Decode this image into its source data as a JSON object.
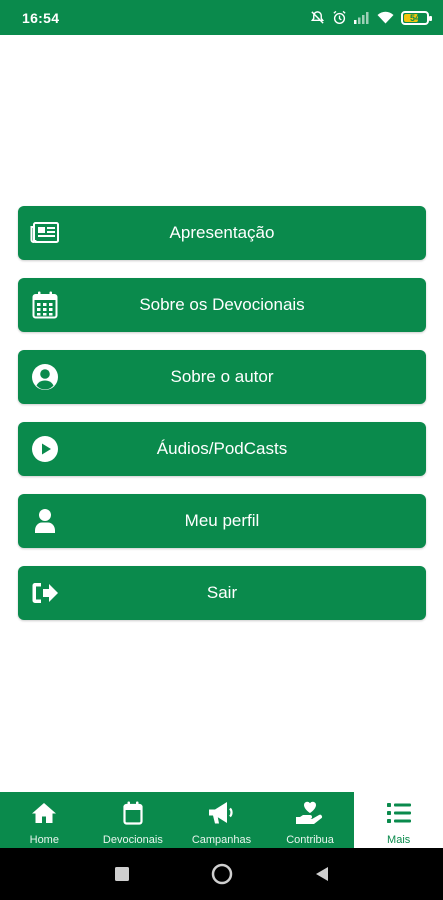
{
  "status_bar": {
    "time": "16:54",
    "battery": "54"
  },
  "menu": {
    "items": [
      {
        "label": "Apresentação",
        "icon": "newspaper-icon"
      },
      {
        "label": "Sobre os Devocionais",
        "icon": "calendar-icon"
      },
      {
        "label": "Sobre o autor",
        "icon": "user-circle-icon"
      },
      {
        "label": "Áudios/PodCasts",
        "icon": "play-circle-icon"
      },
      {
        "label": "Meu perfil",
        "icon": "user-icon"
      },
      {
        "label": "Sair",
        "icon": "sign-out-icon"
      }
    ]
  },
  "bottom_nav": {
    "items": [
      {
        "label": "Home",
        "icon": "home-icon"
      },
      {
        "label": "Devocionais",
        "icon": "calendar-icon"
      },
      {
        "label": "Campanhas",
        "icon": "megaphone-icon"
      },
      {
        "label": "Contribua",
        "icon": "hand-heart-icon"
      },
      {
        "label": "Mais",
        "icon": "list-icon",
        "active": true
      }
    ]
  },
  "colors": {
    "primary": "#0a8a4c",
    "background": "#ffffff",
    "active_tab_bg": "#ffffff",
    "battery_fill": "#f1c40f"
  }
}
